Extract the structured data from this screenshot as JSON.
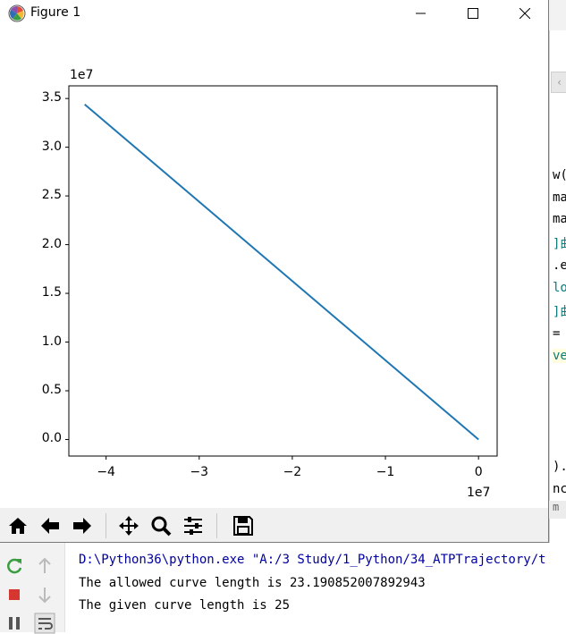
{
  "window": {
    "title": "Figure 1"
  },
  "chart_data": {
    "type": "line",
    "title": "",
    "xlabel": "",
    "ylabel": "",
    "x_offset_text": "1e7",
    "y_offset_text": "1e7",
    "xlim": [
      -4.4,
      0.2
    ],
    "ylim": [
      -0.17,
      3.63
    ],
    "x_ticks": [
      -4,
      -3,
      -2,
      -1,
      0
    ],
    "x_tick_labels": [
      "−4",
      "−3",
      "−2",
      "−1",
      "0"
    ],
    "y_ticks": [
      0.0,
      0.5,
      1.0,
      1.5,
      2.0,
      2.5,
      3.0,
      3.5
    ],
    "y_tick_labels": [
      "0.0",
      "0.5",
      "1.0",
      "1.5",
      "2.0",
      "2.5",
      "3.0",
      "3.5"
    ],
    "series": [
      {
        "x": [
          -4.23,
          0.0
        ],
        "y": [
          3.44,
          0.0
        ],
        "color": "#1f77b4"
      }
    ],
    "grid": false
  },
  "toolbar": {
    "buttons": [
      {
        "id": "home",
        "icon": "home-icon"
      },
      {
        "id": "back",
        "icon": "arrow-left-icon"
      },
      {
        "id": "forward",
        "icon": "arrow-right-icon"
      },
      {
        "id": "pan",
        "icon": "move-icon"
      },
      {
        "id": "zoom",
        "icon": "magnifier-icon"
      },
      {
        "id": "configure",
        "icon": "sliders-icon"
      },
      {
        "id": "save",
        "icon": "save-icon"
      }
    ]
  },
  "console": {
    "lines": [
      "D:\\Python36\\python.exe \"A:/3 Study/1_Python/34_ATPTrajectory/t",
      "The allowed curve length is 23.190852007892943",
      "The given curve length is 25"
    ]
  },
  "ide_fragments": [
    {
      "text": "w(",
      "style": ""
    },
    {
      "text": "ma",
      "style": ""
    },
    {
      "text": "ma",
      "style": ""
    },
    {
      "text": "]曲",
      "style": "teal"
    },
    {
      "text": ".er",
      "style": ""
    },
    {
      "text": "lot",
      "style": "teal"
    },
    {
      "text": "]曲",
      "style": "teal"
    },
    {
      "text": " =",
      "style": ""
    },
    {
      "text": "ve",
      "style": "teal hl"
    },
    {
      "text": ").l",
      "style": ""
    },
    {
      "text": "nce",
      "style": ""
    },
    {
      "text": "m",
      "style": "gray"
    }
  ],
  "colors": {
    "line": "#1f77b4",
    "console_cmd": "#0000a0"
  }
}
